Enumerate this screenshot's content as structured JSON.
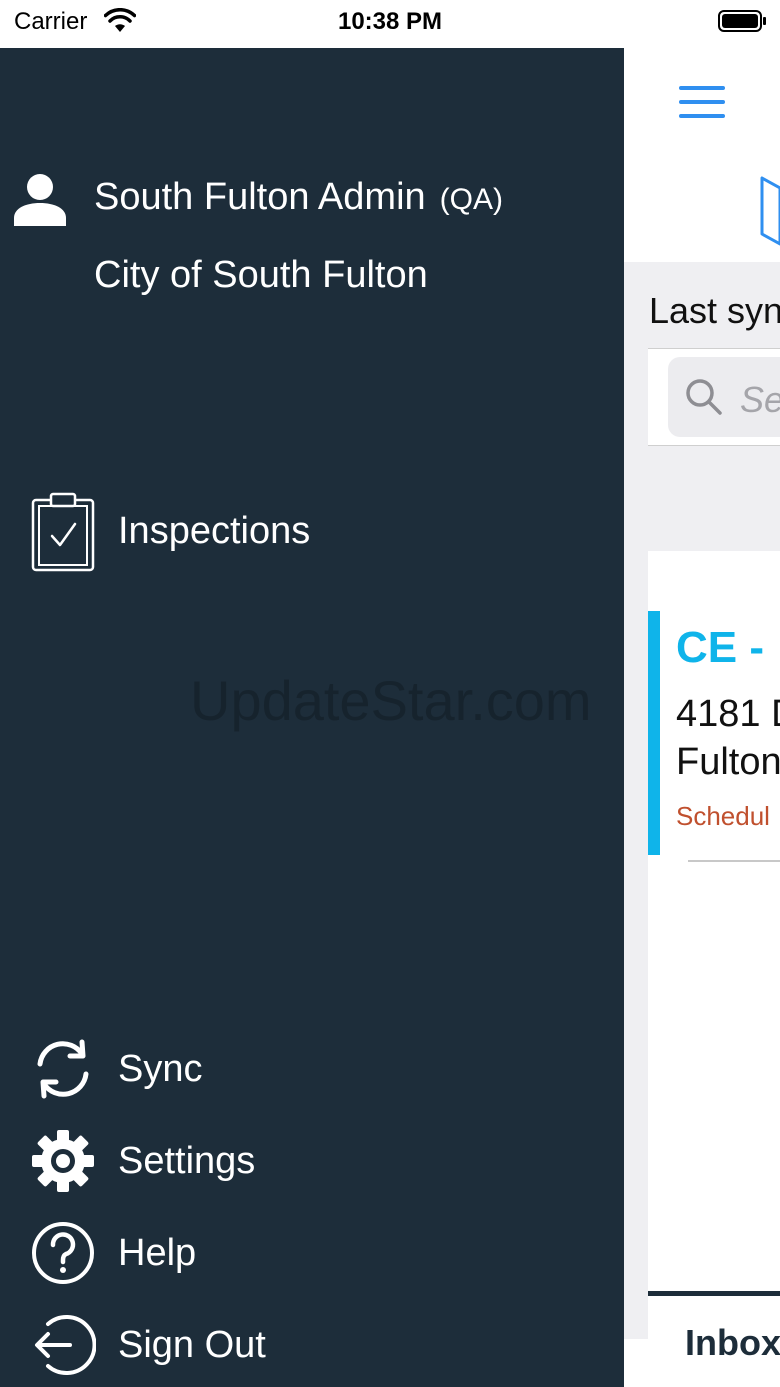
{
  "status_bar": {
    "carrier": "Carrier",
    "time": "10:38 PM"
  },
  "drawer": {
    "user": {
      "name": "South Fulton Admin",
      "environment": "(QA)",
      "organization": "City of South Fulton"
    },
    "primary_items": [
      {
        "label": "Inspections",
        "icon": "clipboard-check-icon"
      }
    ],
    "bottom_items": [
      {
        "label": "Sync",
        "icon": "sync-icon"
      },
      {
        "label": "Settings",
        "icon": "gear-icon"
      },
      {
        "label": "Help",
        "icon": "help-icon"
      },
      {
        "label": "Sign Out",
        "icon": "sign-out-icon"
      }
    ],
    "watermark": "UpdateStar.com"
  },
  "main": {
    "last_sync_label": "Last syn",
    "search_placeholder": "Se",
    "card": {
      "title": "CE -",
      "address_line1": "4181 D",
      "address_line2": "Fulton",
      "status": "Schedul"
    },
    "tab_inbox": "Inbox"
  },
  "colors": {
    "drawer_bg": "#1d2d3a",
    "accent_blue": "#2f8ff0",
    "card_accent": "#0fb4ea",
    "status_orange": "#c0502e"
  }
}
